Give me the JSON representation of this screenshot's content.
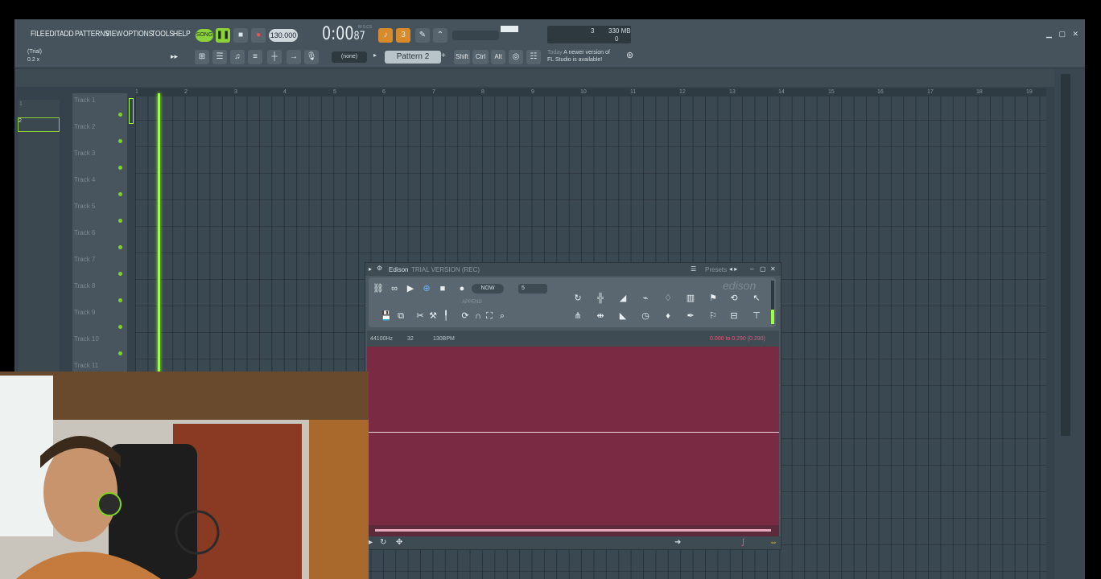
{
  "menu": [
    "FILE",
    "EDIT",
    "ADD",
    "PATTERNS",
    "VIEW",
    "OPTIONS",
    "TOOLS",
    "HELP"
  ],
  "transport": {
    "song_label": "SONG",
    "tempo": "130.000",
    "time": "0:00",
    "time_sub": "87",
    "time_unit": "M:S:CS"
  },
  "memory": {
    "cpu_value": "3",
    "ram": "330 MB",
    "polyphony": "0"
  },
  "hint": {
    "label": "(Trial)",
    "value": "0.2 x"
  },
  "pattern": {
    "snap": "(none)",
    "name": "Pattern 2"
  },
  "modifiers": [
    "Shift",
    "Ctrl",
    "Alt"
  ],
  "news": {
    "when": "Today",
    "line1": "A newer version of",
    "line2": "FL Studio is available!"
  },
  "playlist": {
    "tracks": [
      "Track 1",
      "Track 2",
      "Track 3",
      "Track 4",
      "Track 5",
      "Track 6",
      "Track 7",
      "Track 8",
      "Track 9",
      "Track 10",
      "Track 11"
    ],
    "bars": [
      "1",
      "2",
      "3",
      "4",
      "5",
      "6",
      "7",
      "8",
      "9",
      "10",
      "11",
      "12",
      "13",
      "14",
      "15",
      "16",
      "17",
      "18",
      "19"
    ],
    "pattern_list": [
      "1",
      "2"
    ]
  },
  "edison": {
    "title": "Edison",
    "subtitle": "TRIAL VERSION (REC)",
    "presets": "Presets",
    "brand": "edison",
    "now": "NOW",
    "for_value": "5",
    "append": "APPEND",
    "samplerate": "44100Hz",
    "format": "32",
    "tempo": "130BPM",
    "selection": "0.000 to 0.290 (0.290)"
  },
  "colors": {
    "accent_green": "#9cff45",
    "edison_wave_bg": "#7a2a43",
    "window_bg": "#3a4750"
  }
}
